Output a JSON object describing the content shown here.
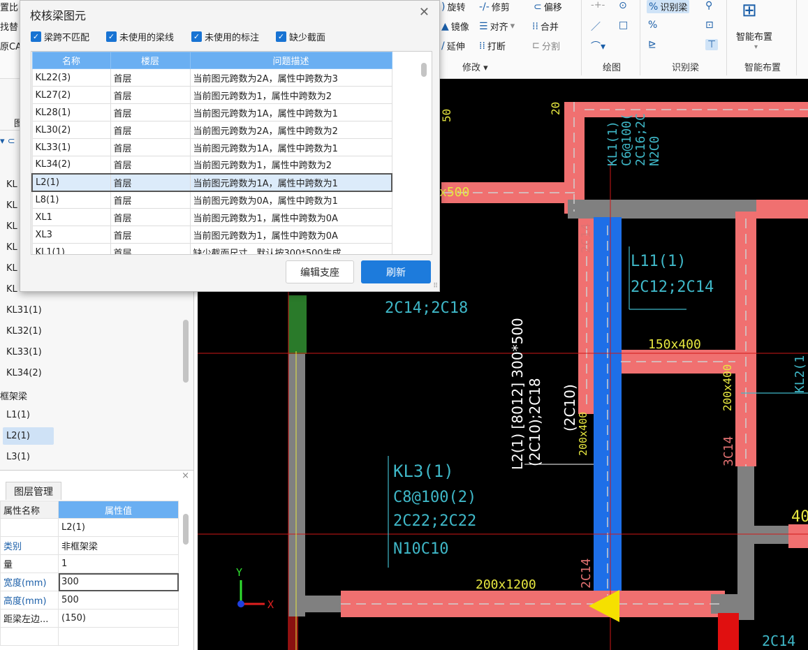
{
  "ribbon": {
    "left_clipped": [
      "置比",
      "找替",
      "原CA"
    ],
    "modify": {
      "rotate": "旋转",
      "trim": "修剪",
      "offset": "偏移",
      "mirror": "镜像",
      "align": "对齐",
      "merge": "合并",
      "extend": "延伸",
      "break": "打断",
      "split": "分割",
      "group_label": "修改 ▾"
    },
    "draw": {
      "group_label": "绘图"
    },
    "recognize": {
      "recognize_beam": "识别梁",
      "group_label": "识别梁"
    },
    "smart": {
      "label": "智能布置",
      "group_label": "智能布置"
    }
  },
  "dialog": {
    "title": "校核梁图元",
    "filters": [
      {
        "label": "梁跨不匹配",
        "checked": true
      },
      {
        "label": "未使用的梁线",
        "checked": true
      },
      {
        "label": "未使用的标注",
        "checked": true
      },
      {
        "label": "缺少截面",
        "checked": true
      }
    ],
    "columns": [
      "名称",
      "楼层",
      "问题描述"
    ],
    "rows": [
      {
        "name": "KL22(3)",
        "floor": "首层",
        "desc": "当前图元跨数为2A，属性中跨数为3"
      },
      {
        "name": "KL27(2)",
        "floor": "首层",
        "desc": "当前图元跨数为1，属性中跨数为2"
      },
      {
        "name": "KL28(1)",
        "floor": "首层",
        "desc": "当前图元跨数为1A，属性中跨数为1"
      },
      {
        "name": "KL30(2)",
        "floor": "首层",
        "desc": "当前图元跨数为2A，属性中跨数为2"
      },
      {
        "name": "KL33(1)",
        "floor": "首层",
        "desc": "当前图元跨数为1A，属性中跨数为1"
      },
      {
        "name": "KL34(2)",
        "floor": "首层",
        "desc": "当前图元跨数为1，属性中跨数为2"
      },
      {
        "name": "L2(1)",
        "floor": "首层",
        "desc": "当前图元跨数为1A，属性中跨数为1"
      },
      {
        "name": "L8(1)",
        "floor": "首层",
        "desc": "当前图元跨数为0A，属性中跨数为1"
      },
      {
        "name": "XL1",
        "floor": "首层",
        "desc": "当前图元跨数为1，属性中跨数为0A"
      },
      {
        "name": "XL3",
        "floor": "首层",
        "desc": "当前图元跨数为1，属性中跨数为0A"
      },
      {
        "name": "KL1(1)",
        "floor": "首层",
        "desc": "缺少截面尺寸，默认按300*500生成"
      }
    ],
    "selected_row": 6,
    "edit_support_button": "编辑支座",
    "refresh_button": "刷新"
  },
  "tree": {
    "items_clipped": [
      "KL",
      "KL",
      "KL",
      "KL",
      "KL",
      "KL"
    ],
    "items": [
      "KL31(1)",
      "KL32(1)",
      "KL33(1)",
      "KL34(2)"
    ],
    "folder": "框架梁",
    "children": [
      "L1(1)",
      "L2(1)",
      "L3(1)"
    ],
    "selected": "L2(1)"
  },
  "props": {
    "tab": "图层管理",
    "header": {
      "name": "属性名称",
      "value": "属性值"
    },
    "rows": [
      {
        "k": "",
        "v": "L2(1)",
        "blue": false
      },
      {
        "k": "类别",
        "v": "非框架梁",
        "blue": true
      },
      {
        "k": "量",
        "v": "1",
        "blue": false
      },
      {
        "k": "宽度(mm)",
        "v": "300",
        "blue": true
      },
      {
        "k": "高度(mm)",
        "v": "500",
        "blue": true
      },
      {
        "k": "距梁左边...",
        "v": "(150)",
        "blue": false
      }
    ]
  },
  "cad": {
    "labels": {
      "kl1": "KL1(1)\nC6@100(\n2C16;2C\nN2C0",
      "l11": "L11(1)",
      "l11_rebar": "2C12;2C14",
      "sec150": "150x400",
      "sec200x400": "200x400",
      "kl2": "KL2(1",
      "c14": "2C14",
      "c14b": "3C14",
      "rebar_left": "2C14;2C18",
      "l21_main": "L2(1) [8012] 300*500",
      "l21_sub": "(2C10);2C18",
      "l21_sub2": "(2C10)",
      "sec200x400b": "200x400",
      "kl3": "KL3(1)",
      "kl3_s": "C8@100(2)",
      "kl3_r": "2C22;2C22",
      "kl3_n": "N10C10",
      "sec200x1200": "200x1200",
      "x500": "x500",
      "n20": "20",
      "n40": "40",
      "n50": "50",
      "axis_y": "Y",
      "axis_x": "X"
    }
  }
}
